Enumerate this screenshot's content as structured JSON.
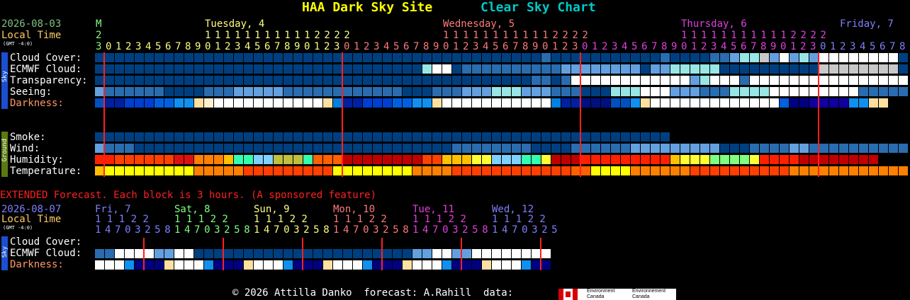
{
  "header": {
    "site_name": "HAA Dark Sky Site",
    "chart_name": "Clear Sky Chart",
    "site_color": "#ffff00",
    "chart_color": "#00c8c8"
  },
  "main": {
    "date": "2026-08-03",
    "local_time_label": "Local Time",
    "gmt_offset": "(GMT -4:0)",
    "day_start_label": "M",
    "first_hour_top": "2",
    "days": [
      {
        "label": "Tuesday, 4",
        "color": "#ffff80",
        "tens": "1 1 1 1 1 1 1 1 1 1 1 2 2 2 2"
      },
      {
        "label": "Wednesday, 5",
        "color": "#ff7a7a",
        "tens": "1 1 1 1 1 1 1 1 1 1 1 2 2 2 2"
      },
      {
        "label": "Thursday, 6",
        "color": "#e040e0",
        "tens": "1 1 1 1 1 1 1 1 1 1 1 2 2 2 2"
      },
      {
        "label": "Friday, 7",
        "color": "#7f7fff",
        "tens": ""
      }
    ],
    "hour_units": "30123456789012345678901230123456789012345678901230123456789012345678901230123456789012345678901230123456789012345678",
    "sky_rows": [
      "Cloud Cover:",
      "ECMWF Cloud:",
      "Transparency:",
      "Seeing:",
      "Darkness:"
    ],
    "ground_rows": [
      "Smoke:",
      "Wind:",
      "Humidity:",
      "Temperature:"
    ],
    "sky_tab_label": "Sky",
    "ground_tab_label": "Ground",
    "rows": {
      "cloud": "DDDDDDDDDDDDDDDDDDDDDDDDDDDDDDDDDDDDDDDDDDDDDDDDDDDDDDDDDDDDDDDDDDDDDDDDDDDDDDDDDDDDDDDDDDDDDDDDDDDDDDDDDDDDDDDDDD",
      "ecmwf": "DDDDDDDDDDDDDDDDDDDDDDDDDDDDDDDDDDDDDDDDDDDDDDDDDDDDDDDDDDDDDDDDDDDDDDDDDDDDDDDDDDDDDDDDDDDDDDDDDDDDDDDDDDDDDDDDDD",
      "transp": "DDDDDDDDDDDDDDDDDDDDDDDDDDDDDDDDDDDDDDDDDDDDDDDDDDDDDDDDDDDDDDDDDDDDDDDDDDDDDDDDDDDDDDDDDDDDDDDDDDDDDDDDDDDDDDDDDD",
      "seeing": "MMMMMMMMMMMMMMMMMMMMMMMMMMMMMMMMMMMMMMMMMMMMMMMMMMMMMMMMMMMMMMMMMMMMMMMMMMMMMMMMMMMMMMMMMMMMMMMMMMMMMMMMMMMMMMMMMM",
      "dark": "dark-sequence"
    },
    "cloud_row": [
      "D",
      "D",
      "D",
      "D",
      "D",
      "D",
      "D",
      "D",
      "D",
      "D",
      "D",
      "D",
      "D",
      "D",
      "D",
      "D",
      "D",
      "D",
      "D",
      "D",
      "D",
      "D",
      "D",
      "D",
      "D",
      "D",
      "D",
      "D",
      "D",
      "D",
      "D",
      "D",
      "D",
      "D",
      "D",
      "D",
      "D",
      "D",
      "D",
      "D",
      "D",
      "D",
      "D",
      "D",
      "D",
      "D",
      "D",
      "D",
      "D",
      "D",
      "D",
      "D",
      "D",
      "D",
      "D",
      "D",
      "D",
      "D",
      "D",
      "D",
      "D",
      "D",
      "M",
      "L",
      "P",
      "W",
      "P",
      "L",
      "W",
      "L",
      "W",
      "W",
      "W",
      "W",
      "W",
      "W",
      "W",
      "W",
      "W",
      "W",
      "D",
      "D",
      "D",
      "D",
      "D",
      "D",
      "D",
      "D",
      "D",
      "D",
      "D",
      "D",
      "D",
      "M",
      "L",
      "P",
      "W",
      "W",
      "L",
      "W",
      "W",
      "W",
      "W",
      "W",
      "W",
      "W",
      "W",
      "W",
      "W",
      "W"
    ],
    "ecmwf_row": [
      "D",
      "D",
      "D",
      "D",
      "D",
      "D",
      "D",
      "D",
      "D",
      "D",
      "D",
      "D",
      "D",
      "D",
      "D",
      "D",
      "D",
      "D",
      "D",
      "D",
      "D",
      "D",
      "D",
      "D",
      "D",
      "D",
      "D",
      "D",
      "D",
      "D",
      "D",
      "D",
      "D",
      "D",
      "D",
      "D",
      "D",
      "D",
      "D",
      "D",
      "D",
      "D",
      "D",
      "D",
      "D",
      "D",
      "D",
      "D",
      "D",
      "D",
      "D",
      "D",
      "D",
      "D",
      "D",
      "D",
      "D",
      "D",
      "D",
      "D",
      "D",
      "D",
      "D",
      "D",
      "D",
      "D",
      "D",
      "D",
      "D",
      "D",
      "D",
      "D",
      "D",
      "D",
      "D",
      "D",
      "D",
      "D",
      "D",
      "D",
      "D",
      "D",
      "D",
      "D",
      "D",
      "D",
      "D",
      "D",
      "D",
      "D",
      "D",
      "D",
      "D",
      "D",
      "D",
      "D",
      "D",
      "D",
      "D",
      "D",
      "D",
      "D",
      "D",
      "D",
      "D",
      "D",
      "D",
      "D",
      "D",
      "D",
      "D",
      "D",
      "D",
      "D",
      "D",
      "D"
    ],
    "legend_note": "",
    "ext_title": "EXTENDED Forecast. Each block is 3 hours. (A sponsored feature)",
    "ext_date": "2026-08-07",
    "ext_days": [
      {
        "label": "Fri, 7",
        "color": "#7f7fff",
        "top": "1 1 1 2 2",
        "bottom": "1 4 7 0 3 2 5 8"
      },
      {
        "label": "Sat, 8",
        "color": "#80ff80",
        "top": "1 1 1 2 2",
        "bottom": "1 4 7 0 3 2 5 8"
      },
      {
        "label": "Sun, 9",
        "color": "#ffff80",
        "top": "1 1 1 2 2",
        "bottom": "1 4 7 0 3 2 5 8"
      },
      {
        "label": "Mon, 10",
        "color": "#ff7a7a",
        "top": "1 1 1 2 2",
        "bottom": "1 4 7 0 3 2 5 8"
      },
      {
        "label": "Tue, 11",
        "color": "#e040e0",
        "top": "1 1 1 2 2",
        "bottom": "1 4 7 0 3 2 5 8"
      },
      {
        "label": "Wed, 12",
        "color": "#7f7fff",
        "top": "1 1 1 2 2",
        "bottom": "1 4 7 0 3 2 5"
      }
    ],
    "ext_rows": [
      "Cloud Cover:",
      "ECMWF Cloud:",
      "Darkness:"
    ],
    "footer": "© 2026 Attilla Danko  forecast: A.Rahill  data:",
    "logo_text_1": "Environment",
    "logo_text_2": "Canada",
    "logo_text_3": "Environnement",
    "logo_text_4": "Canada"
  },
  "colors": {
    "dark_blue": "#003f7f",
    "mid_blue": "#2a6cb0",
    "light_blue": "#63a0e0",
    "pale_cyan": "#99e6e6",
    "white": "#ffffff",
    "label_white": "#ffffff",
    "darkness_label": "#ff9966",
    "green": "#7fbf3f",
    "local_time_label": "#ffcc66",
    "date_label": "#80c080",
    "tens_label": "#c0c040",
    "ext_red": "#ff2020",
    "sky_tab": "#1a4fd0",
    "ground_tab": "#5a7a10",
    "midnight_line": "#ff2020"
  }
}
